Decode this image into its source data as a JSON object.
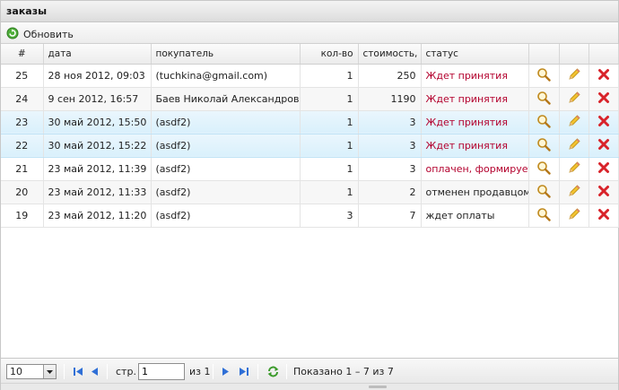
{
  "panel": {
    "title": "заказы"
  },
  "toolbar": {
    "refresh_label": "Обновить"
  },
  "grid": {
    "columns": [
      "#",
      "дата",
      "покупатель",
      "кол-во",
      "стоимость, р.",
      "статус"
    ],
    "rows": [
      {
        "id": "25",
        "date": "28 ноя 2012, 09:03",
        "customer": "(tuchkina@gmail.com)",
        "qty": "1",
        "cost": "250",
        "status": "Ждет принятия",
        "status_red": true,
        "style": "plain"
      },
      {
        "id": "24",
        "date": "9 сен 2012, 16:57",
        "customer": "Баев Николай Александрович",
        "qty": "1",
        "cost": "1190",
        "status": "Ждет принятия",
        "status_red": true,
        "style": "alt"
      },
      {
        "id": "23",
        "date": "30 май 2012, 15:50",
        "customer": "(asdf2)",
        "qty": "1",
        "cost": "3",
        "status": "Ждет принятия",
        "status_red": true,
        "style": "sel"
      },
      {
        "id": "22",
        "date": "30 май 2012, 15:22",
        "customer": "(asdf2)",
        "qty": "1",
        "cost": "3",
        "status": "Ждет принятия",
        "status_red": true,
        "style": "sel"
      },
      {
        "id": "21",
        "date": "23 май 2012, 11:39",
        "customer": "(asdf2)",
        "qty": "1",
        "cost": "3",
        "status": "оплачен, формируется",
        "status_red": true,
        "style": "plain"
      },
      {
        "id": "20",
        "date": "23 май 2012, 11:33",
        "customer": "(asdf2)",
        "qty": "1",
        "cost": "2",
        "status": "отменен продавцом",
        "status_red": false,
        "style": "alt"
      },
      {
        "id": "19",
        "date": "23 май 2012, 11:20",
        "customer": "(asdf2)",
        "qty": "3",
        "cost": "7",
        "status": "ждет оплаты",
        "status_red": false,
        "style": "plain"
      }
    ],
    "row_icons": [
      "magnifier-icon",
      "pencil-icon",
      "delete-x-icon"
    ]
  },
  "pager": {
    "page_size": "10",
    "page_label": "стр.",
    "page_value": "1",
    "of_label": "из 1",
    "summary": "Показано 1 – 7 из 7"
  },
  "colors": {
    "status_red": "#b3002d",
    "selected_row": "#d9f0fc",
    "delete_red": "#d8232a",
    "pager_blue": "#2f6fd6",
    "refresh_green": "#3a9a2a"
  }
}
